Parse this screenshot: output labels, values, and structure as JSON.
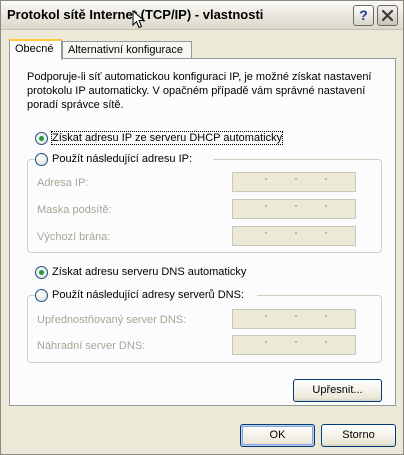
{
  "window": {
    "title": "Protokol sítě Internet (TCP/IP) - vlastnosti",
    "help_label": "?"
  },
  "tabs": [
    {
      "label": "Obecné",
      "active": true
    },
    {
      "label": "Alternativní konfigurace",
      "active": false
    }
  ],
  "description": "Podporuje-li síť automatickou konfiguraci IP, je možné získat nastavení protokolu IP automaticky. V opačném případě vám správné nastavení poradí správce sítě.",
  "ip_section": {
    "auto_label": "Získat adresu IP ze serveru DHCP automaticky",
    "auto_selected": true,
    "manual_label": "Použít následující adresu IP:",
    "fields": [
      {
        "label": "Adresa IP:",
        "value": ""
      },
      {
        "label": "Maska podsítě:",
        "value": ""
      },
      {
        "label": "Výchozí brána:",
        "value": ""
      }
    ]
  },
  "dns_section": {
    "auto_label": "Získat adresu serveru DNS automaticky",
    "auto_selected": true,
    "manual_label": "Použít následující adresy serverů DNS:",
    "fields": [
      {
        "label": "Upřednostňovaný server DNS:",
        "value": ""
      },
      {
        "label": "Náhradní server DNS:",
        "value": ""
      }
    ]
  },
  "buttons": {
    "advanced": "Upřesnit...",
    "ok": "OK",
    "cancel": "Storno"
  }
}
